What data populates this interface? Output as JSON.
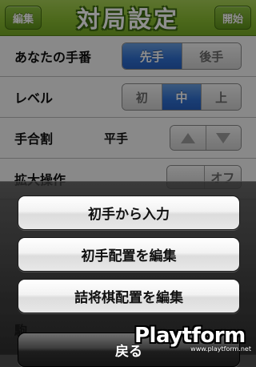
{
  "header": {
    "left_button": "編集",
    "title": "対局設定",
    "right_button": "開始"
  },
  "settings": {
    "turn": {
      "label": "あなたの手番",
      "options": [
        "先手",
        "後手"
      ],
      "selected": "先手"
    },
    "level": {
      "label": "レベル",
      "options": [
        "初",
        "中",
        "上"
      ],
      "selected": "中"
    },
    "handicap": {
      "label": "手合割",
      "value": "平手"
    },
    "zoom": {
      "label": "拡大操作",
      "toggle": "オフ"
    },
    "extra": {
      "label": "駒"
    }
  },
  "action_sheet": {
    "buttons": [
      "初手から入力",
      "初手配置を編集",
      "詰将棋配置を編集"
    ],
    "cancel": "戻る"
  },
  "watermark": {
    "brand": "Playtform",
    "url": "www.playtform.net"
  },
  "colors": {
    "header_green": "#89bb32",
    "selected_blue": "#2f6fd0"
  }
}
